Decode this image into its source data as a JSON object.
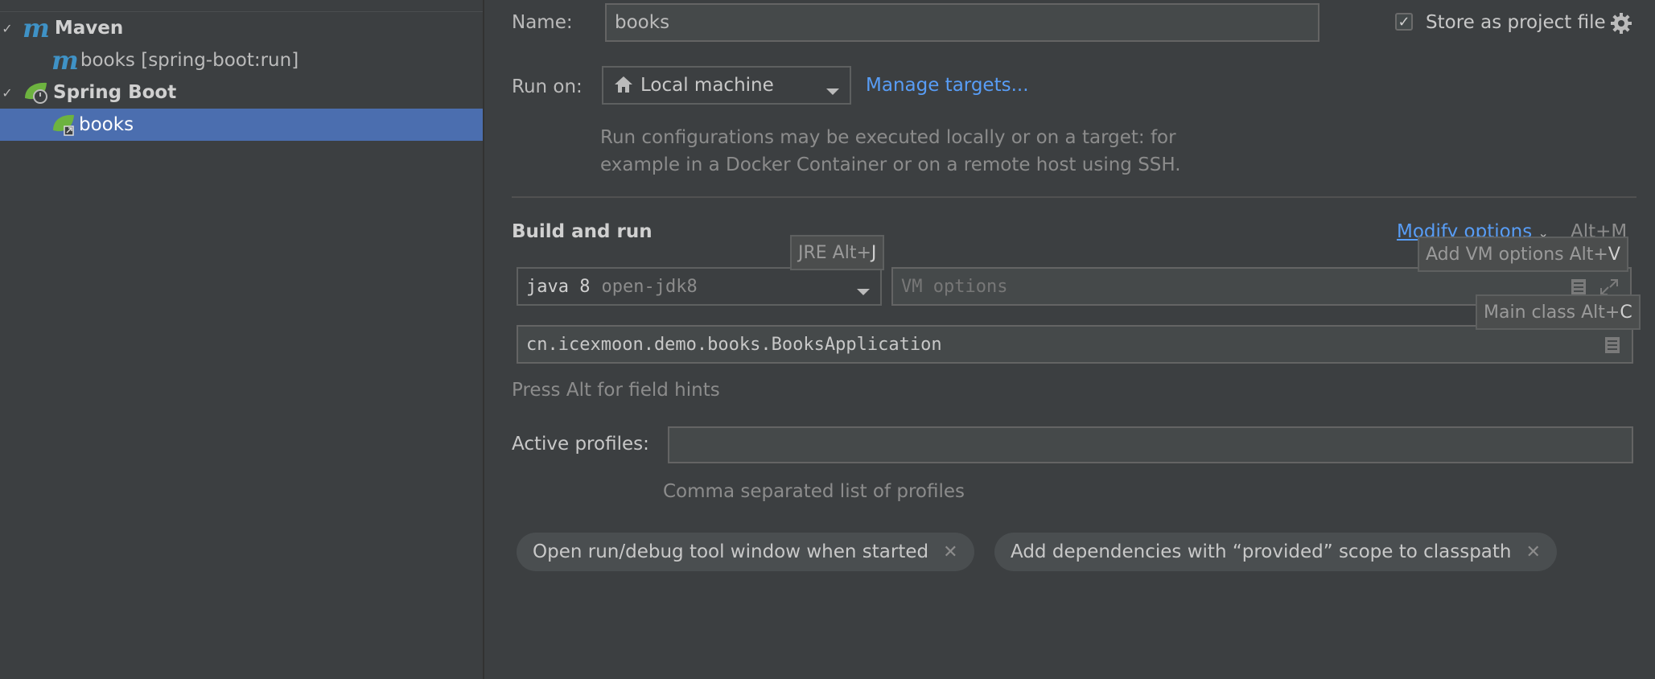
{
  "tree": {
    "items": [
      {
        "label": "Maven",
        "icon": "maven-icon",
        "expanded": true
      },
      {
        "label": "books [spring-boot:run]",
        "icon": "maven-icon"
      },
      {
        "label": "Spring Boot",
        "icon": "spring-boot-icon",
        "expanded": true
      },
      {
        "label": "books",
        "icon": "spring-boot-app-icon",
        "selected": true
      }
    ],
    "maven_glyph": "m"
  },
  "header": {
    "name_label": "Name:",
    "name_value": "books",
    "store_label": "Store as project file",
    "store_checked": true
  },
  "run_on": {
    "label": "Run on:",
    "value": "Local machine",
    "manage_link": "Manage targets...",
    "description_line1": "Run configurations may be executed locally or on a target: for",
    "description_line2": "example in a Docker Container or on a remote host using SSH."
  },
  "build": {
    "title": "Build and run",
    "modify_options": "Modify options",
    "modify_shortcut": "Alt+M",
    "jre_main": "java 8",
    "jre_sub": "open-jdk8",
    "vm_placeholder": "VM options",
    "main_class": "cn.icexmoon.demo.books.BooksApplication",
    "field_hints": "Press Alt for field hints"
  },
  "tooltips": {
    "jre_prefix": "JRE Alt+",
    "jre_key": "J",
    "vm_prefix": "Add VM options Alt+",
    "vm_key": "V",
    "main_prefix": "Main class Alt+",
    "main_key": "C"
  },
  "profiles": {
    "label": "Active profiles:",
    "value": "",
    "hint": "Comma separated list of profiles"
  },
  "chips": [
    {
      "label": "Open run/debug tool window when started"
    },
    {
      "label": "Add dependencies with “provided” scope to classpath"
    }
  ],
  "colors": {
    "background": "#3c3f41",
    "selection": "#4b6eaf",
    "link": "#589df6",
    "maven": "#3f92c6",
    "spring": "#6db33f"
  }
}
